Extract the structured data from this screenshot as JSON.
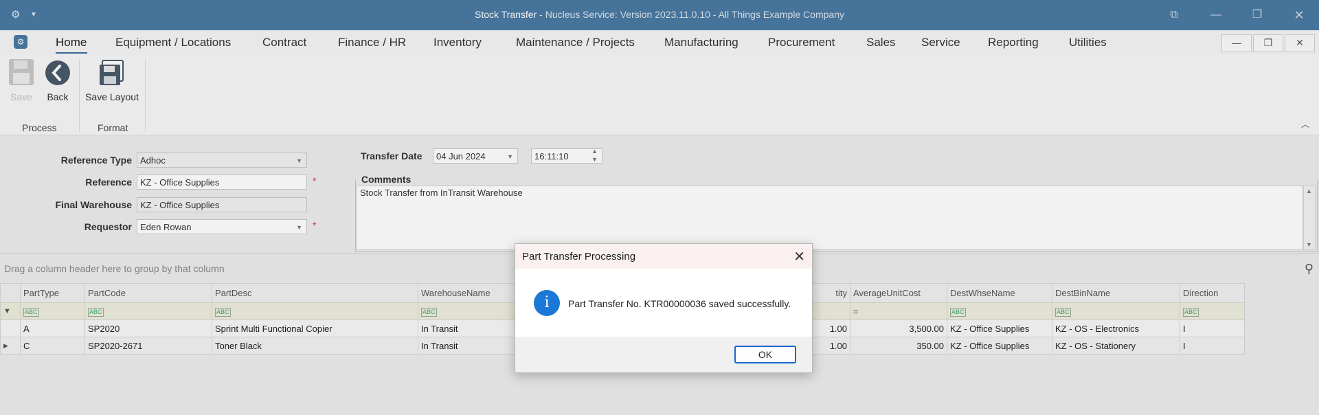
{
  "window": {
    "title_app": "Stock Transfer",
    "title_rest": " - Nucleus Service: Version 2023.11.0.10 - All Things Example Company"
  },
  "menu": {
    "items": [
      "Home",
      "Equipment / Locations",
      "Contract",
      "Finance / HR",
      "Inventory",
      "Maintenance / Projects",
      "Manufacturing",
      "Procurement",
      "Sales",
      "Service",
      "Reporting",
      "Utilities"
    ]
  },
  "ribbon": {
    "save": "Save",
    "back": "Back",
    "save_layout": "Save Layout",
    "group_process": "Process",
    "group_format": "Format"
  },
  "form": {
    "reference_type_label": "Reference Type",
    "reference_type_value": "Adhoc",
    "reference_label": "Reference",
    "reference_value": "KZ - Office Supplies",
    "final_warehouse_label": "Final Warehouse",
    "final_warehouse_value": "KZ - Office Supplies",
    "requestor_label": "Requestor",
    "requestor_value": "Eden Rowan",
    "required_marker": "*",
    "transfer_date_label": "Transfer Date",
    "transfer_date_value": "04 Jun 2024",
    "transfer_time_value": "16:11:10",
    "comments_label": "Comments",
    "comments_value": "Stock Transfer from InTransit Warehouse"
  },
  "grid": {
    "group_hint": "Drag a column header here to group by that column",
    "columns": [
      "PartType",
      "PartCode",
      "PartDesc",
      "WarehouseName",
      "tity",
      "AverageUnitCost",
      "DestWhseName",
      "DestBinName",
      "Direction"
    ],
    "filter_abc": "ABC",
    "filter_eq": "=",
    "rows": [
      [
        "A",
        "SP2020",
        "Sprint Multi Functional Copier",
        "In Transit",
        "1.00",
        "3,500.00",
        "KZ - Office Supplies",
        "KZ - OS - Electronics",
        "I"
      ],
      [
        "C",
        "SP2020-2671",
        "Toner Black",
        "In Transit",
        "1.00",
        "350.00",
        "KZ - Office Supplies",
        "KZ - OS - Stationery",
        "I"
      ]
    ]
  },
  "dialog": {
    "title": "Part Transfer Processing",
    "message": "Part Transfer No. KTR00000036 saved successfully.",
    "ok": "OK"
  },
  "colors": {
    "titlebar": "#4a7aa3",
    "accent": "#1a78d6"
  }
}
